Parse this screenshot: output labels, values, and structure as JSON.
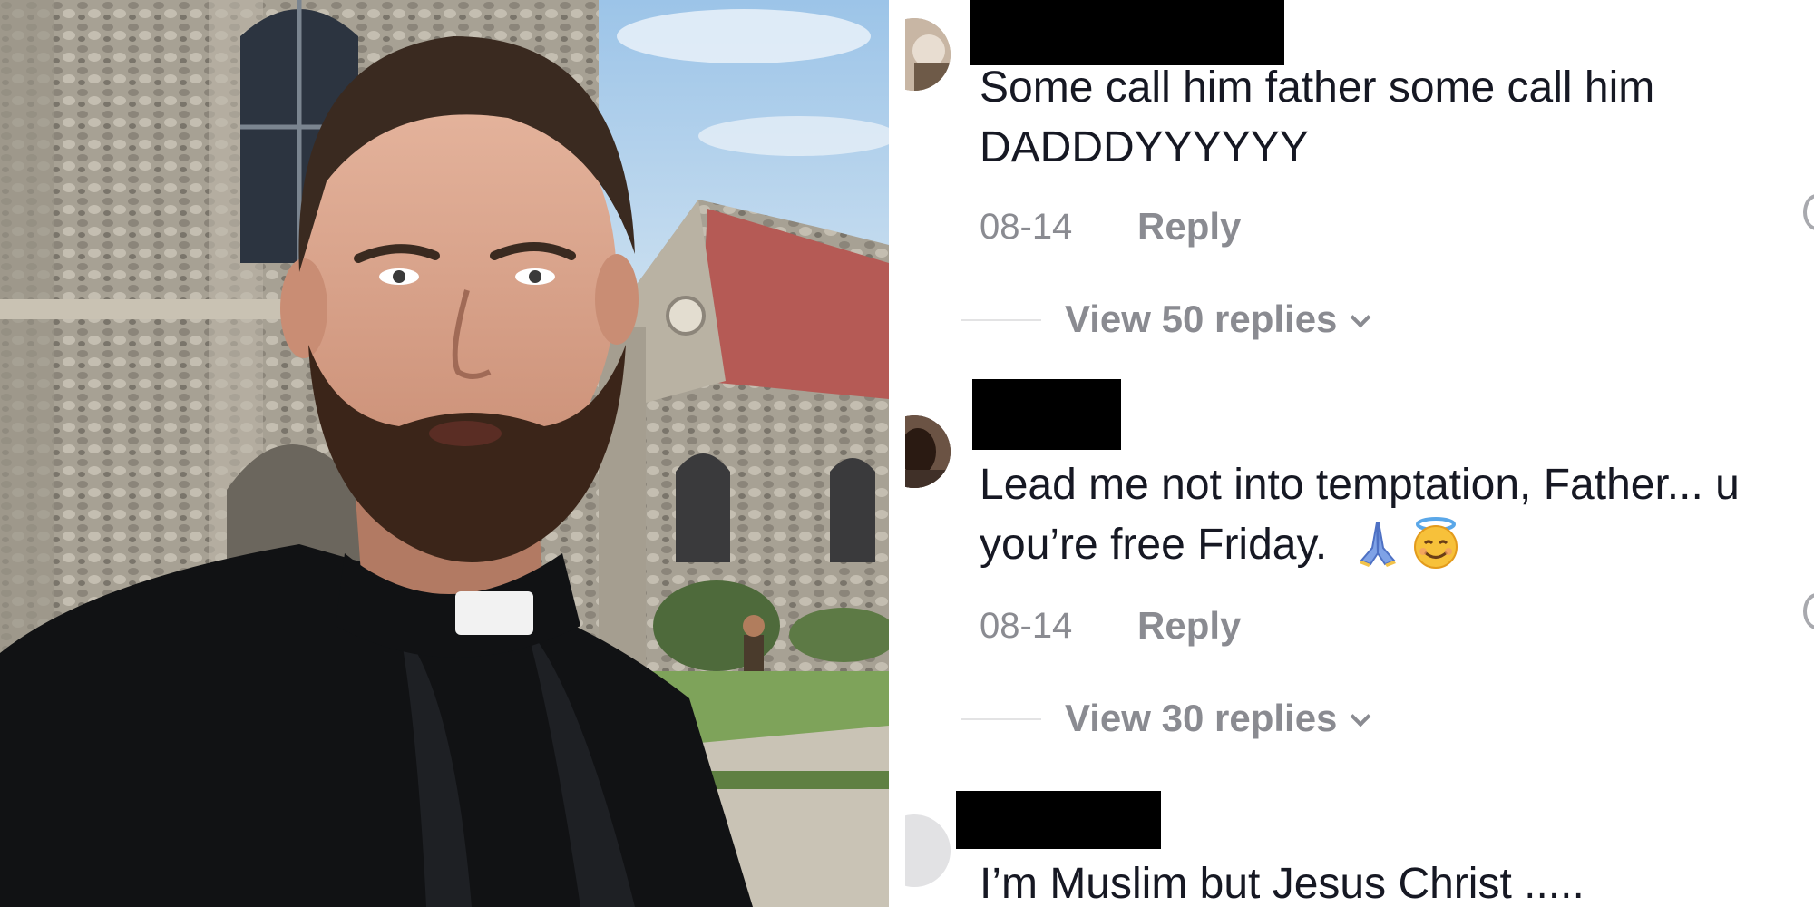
{
  "comments": [
    {
      "text_line1": "Some call him father some call him",
      "text_line2": "DADDDYYYYYY",
      "date": "08-14",
      "reply_label": "Reply",
      "view_replies_label": "View 50 replies"
    },
    {
      "text_line1": "Lead me not into temptation, Father... u",
      "text_line2": "you’re free Friday.",
      "emoji": [
        "folded-hands",
        "smiling-face-with-halo"
      ],
      "date": "08-14",
      "reply_label": "Reply",
      "view_replies_label": "View 30 replies"
    },
    {
      "text_line1": "I’m Muslim but Jesus Christ ....."
    }
  ],
  "colors": {
    "comment_text": "#161823",
    "secondary_text": "#8a8b91",
    "redaction": "#000000"
  }
}
